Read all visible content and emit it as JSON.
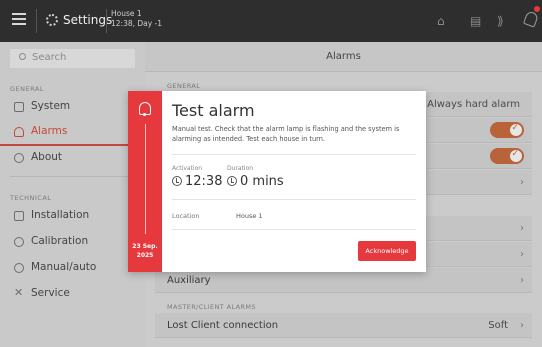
{
  "topbar": {
    "settings_label": "Settings",
    "house_line1": "House 1",
    "house_line2": "12:38, Day -1",
    "icons": [
      "menu-icon",
      "gear-icon",
      "home-icon",
      "tablet-icon",
      "signal-icon",
      "bell-icon"
    ]
  },
  "sidebar": {
    "search_placeholder": "Search",
    "group_general": "GENERAL",
    "group_technical": "TECHNICAL",
    "items": [
      {
        "label": "System",
        "icon": "system-icon"
      },
      {
        "label": "Alarms",
        "icon": "bell-icon"
      },
      {
        "label": "About",
        "icon": "info-icon"
      },
      {
        "label": "Installation",
        "icon": "installation-icon"
      },
      {
        "label": "Calibration",
        "icon": "calibration-icon"
      },
      {
        "label": "Manual/auto",
        "icon": "manual-auto-icon"
      },
      {
        "label": "Service",
        "icon": "service-icon"
      }
    ],
    "active_color": "#c5483b"
  },
  "main": {
    "title": "Alarms",
    "section_general": "GENERAL",
    "always_hard_alarm": "Always hard alarm",
    "auxiliary": "Auxiliary",
    "section_master_client": "MASTER/CLIENT ALARMS",
    "lost_client": "Lost Client connection",
    "lost_client_value": "Soft",
    "toggle_color": "#b8633a"
  },
  "modal": {
    "title": "Test alarm",
    "description": "Manual test. Check that the alarm lamp is flashing and the system is alarming as intended. Test each house in turn.",
    "activation_label": "Activation",
    "activation_value": "12:38",
    "duration_label": "Duration",
    "duration_value": "0 mins",
    "location_label": "Location",
    "location_value": "House 1",
    "date_line1": "23 Sep.",
    "date_line2": "2025",
    "acknowledge_label": "Acknowledge",
    "accent_color": "#e6393e"
  }
}
